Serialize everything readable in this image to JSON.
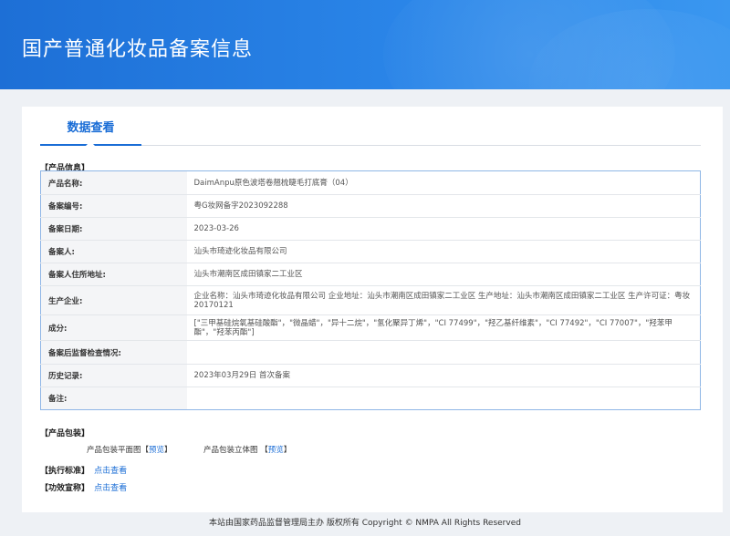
{
  "header": {
    "title": "国产普通化妆品备案信息"
  },
  "tabs": {
    "data_view": "数据查看"
  },
  "sections": {
    "product_info": "【产品信息】",
    "product_package": "【产品包装】",
    "exec_standard": "【执行标准】",
    "efficacy_claim": "【功效宣称】"
  },
  "product_info": {
    "rows": [
      {
        "label": "产品名称:",
        "value": "DaimAnpu原色波塔卷翘梳睫毛打底膏（04）"
      },
      {
        "label": "备案编号:",
        "value": "粤G妆网备字2023092288"
      },
      {
        "label": "备案日期:",
        "value": "2023-03-26"
      },
      {
        "label": "备案人:",
        "value": "汕头市琦迹化妆品有限公司"
      },
      {
        "label": "备案人住所地址:",
        "value": "汕头市潮南区成田镇家二工业区"
      },
      {
        "label": "生产企业:",
        "value": "企业名称：汕头市琦迹化妆品有限公司 企业地址：汕头市潮南区成田镇家二工业区 生产地址：汕头市潮南区成田镇家二工业区 生产许可证：粤妆20170121"
      },
      {
        "label": "成分:",
        "value": "[\"三甲基硅烷氧基硅酸酯\"，\"微晶蜡\"，\"异十二烷\"，\"氢化聚异丁烯\"，\"CI 77499\"，\"羟乙基纤维素\"，\"CI 77492\"，\"CI 77007\"，\"羟苯甲酯\"，\"羟苯丙酯\"]"
      },
      {
        "label": "备案后监督检查情况:",
        "value": ""
      },
      {
        "label": "历史记录:",
        "value": "2023年03月29日 首次备案"
      },
      {
        "label": "备注:",
        "value": ""
      }
    ]
  },
  "package": {
    "flat_label": "产品包装平面图【",
    "flat_link": "预览",
    "flat_close": "】",
    "solid_label": "产品包装立体图 【",
    "solid_link": "预览",
    "solid_close": "】"
  },
  "links": {
    "view1": "点击查看",
    "view2": "点击查看"
  },
  "footer": {
    "text": "本站由国家药品监督管理局主办 版权所有 Copyright © NMPA All Rights Reserved"
  }
}
